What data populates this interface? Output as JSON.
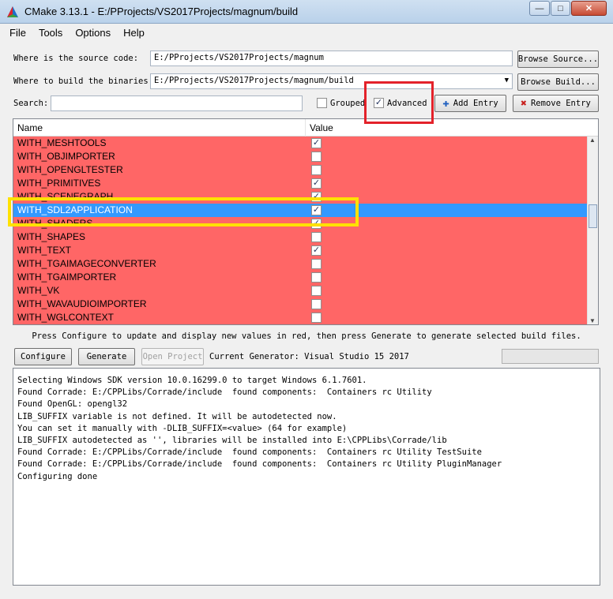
{
  "window": {
    "title": "CMake 3.13.1 - E:/PProjects/VS2017Projects/magnum/build"
  },
  "menu": [
    "File",
    "Tools",
    "Options",
    "Help"
  ],
  "source": {
    "label": "Where is the source code:",
    "value": "E:/PProjects/VS2017Projects/magnum",
    "button": "Browse Source..."
  },
  "build": {
    "label": "Where to build the binaries:",
    "value": "E:/PProjects/VS2017Projects/magnum/build",
    "button": "Browse Build..."
  },
  "search": {
    "label": "Search:",
    "value": ""
  },
  "grouped": {
    "label": "Grouped",
    "checked": false
  },
  "advanced": {
    "label": "Advanced",
    "checked": true
  },
  "add_entry": "Add Entry",
  "remove_entry": "Remove Entry",
  "table": {
    "headers": [
      "Name",
      "Value"
    ],
    "rows": [
      {
        "name": "WITH_MESHTOOLS",
        "checked": true
      },
      {
        "name": "WITH_OBJIMPORTER",
        "checked": false
      },
      {
        "name": "WITH_OPENGLTESTER",
        "checked": false
      },
      {
        "name": "WITH_PRIMITIVES",
        "checked": true
      },
      {
        "name": "WITH_SCENEGRAPH",
        "checked": true
      },
      {
        "name": "WITH_SDL2APPLICATION",
        "checked": true,
        "selected": true
      },
      {
        "name": "WITH_SHADERS",
        "checked": true
      },
      {
        "name": "WITH_SHAPES",
        "checked": false
      },
      {
        "name": "WITH_TEXT",
        "checked": true
      },
      {
        "name": "WITH_TGAIMAGECONVERTER",
        "checked": false
      },
      {
        "name": "WITH_TGAIMPORTER",
        "checked": false
      },
      {
        "name": "WITH_VK",
        "checked": false
      },
      {
        "name": "WITH_WAVAUDIOIMPORTER",
        "checked": false
      },
      {
        "name": "WITH_WGLCONTEXT",
        "checked": false
      }
    ]
  },
  "hint": "Press Configure to update and display new values in red, then press Generate to generate selected build files.",
  "buttons": {
    "configure": "Configure",
    "generate": "Generate",
    "open_project": "Open Project"
  },
  "generator": "Current Generator: Visual Studio 15 2017",
  "log": [
    "Selecting Windows SDK version 10.0.16299.0 to target Windows 6.1.7601.",
    "Found Corrade: E:/CPPLibs/Corrade/include  found components:  Containers rc Utility",
    "Found OpenGL: opengl32",
    "LIB_SUFFIX variable is not defined. It will be autodetected now.",
    "You can set it manually with -DLIB_SUFFIX=<value> (64 for example)",
    "LIB_SUFFIX autodetected as '', libraries will be installed into E:\\CPPLibs\\Corrade/lib",
    "Found Corrade: E:/CPPLibs/Corrade/include  found components:  Containers rc Utility TestSuite",
    "Found Corrade: E:/CPPLibs/Corrade/include  found components:  Containers rc Utility PluginManager",
    "Configuring done"
  ],
  "colors": {
    "changed_row": "#ff6666",
    "selected_row": "#3399ff",
    "highlight_red": "#e3222a",
    "highlight_yellow": "#ffe100"
  }
}
